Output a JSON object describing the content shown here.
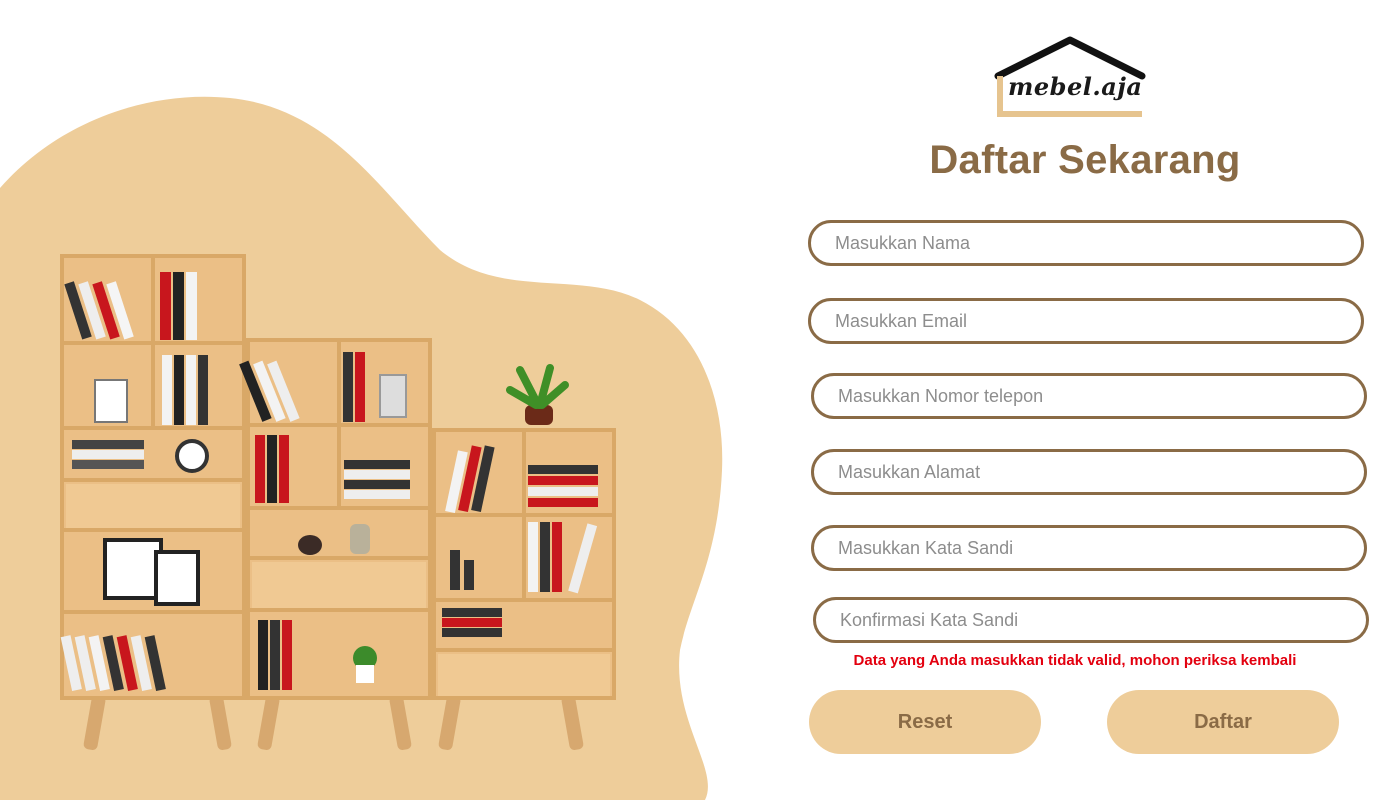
{
  "brand": {
    "logo_text": "mebel.aja",
    "accent": "#8a6b46",
    "blob_color": "#eecd9a"
  },
  "form": {
    "title": "Daftar Sekarang",
    "fields": {
      "name": {
        "placeholder": "Masukkan Nama",
        "value": ""
      },
      "email": {
        "placeholder": "Masukkan Email",
        "value": ""
      },
      "phone": {
        "placeholder": "Masukkan Nomor telepon",
        "value": ""
      },
      "address": {
        "placeholder": "Masukkan Alamat",
        "value": ""
      },
      "password": {
        "placeholder": "Masukkan Kata Sandi",
        "value": ""
      },
      "confirm": {
        "placeholder": "Konfirmasi Kata Sandi",
        "value": ""
      }
    },
    "error_message": "Data yang Anda masukkan tidak valid, mohon periksa kembali",
    "error_color": "#e3000f",
    "reset_label": "Reset",
    "submit_label": "Daftar"
  },
  "illustration": {
    "icon": "bookshelf-illustration"
  }
}
